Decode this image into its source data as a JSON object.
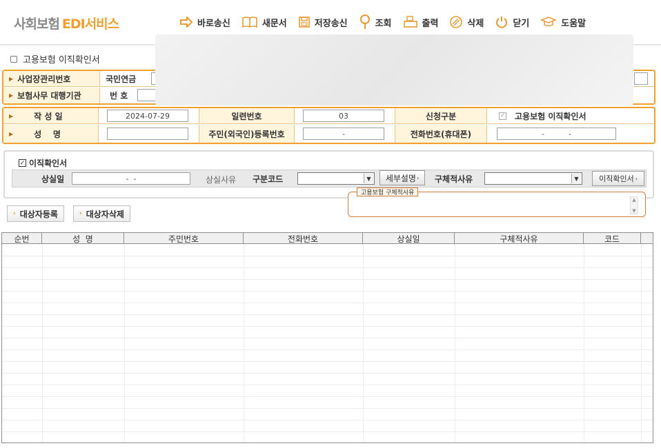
{
  "header": {
    "logo_kr": "사회보험",
    "logo_edi": "EDI서비스",
    "tools": [
      "바로송신",
      "새문서",
      "저장송신",
      "조회",
      "출력",
      "삭제",
      "닫기",
      "도움말"
    ]
  },
  "page_title": "고용보험 이직확인서",
  "top_form": {
    "row1_label": "사업장관리번호",
    "row1_sub": "국민연금",
    "row2_label": "보험사무 대행기관",
    "row2_sub": "번 호"
  },
  "main_form": {
    "write_date_label": "작 성 일",
    "write_date": "2024-07-29",
    "serial_label": "일련번호",
    "serial": "03",
    "apply_type_label": "신청구분",
    "apply_type_value": "고용보험 이직확인서",
    "name_label": "성    명",
    "name_value": "",
    "resident_label": "주민(외국인)등록번호",
    "resident_value": "-",
    "phone_label": "전화번호(휴대폰)",
    "phone_value": "-          -"
  },
  "panel": {
    "checkbox_label": "이직확인서",
    "loss_date_label": "상실일",
    "loss_date_value": "-  -",
    "loss_reason_label": "상실사유",
    "code_label": "구분코드",
    "detail_btn": "세부설명",
    "specific_label": "구체적사유",
    "confirm_btn": "이직확인서",
    "tip_label": "고용보험 구체적사유"
  },
  "actions": {
    "register": "대상자등록",
    "delete": "대상자삭제"
  },
  "grid": {
    "columns": [
      "순번",
      "성  명",
      "주민번호",
      "전화번호",
      "상실일",
      "구체적사유",
      "코드"
    ]
  }
}
